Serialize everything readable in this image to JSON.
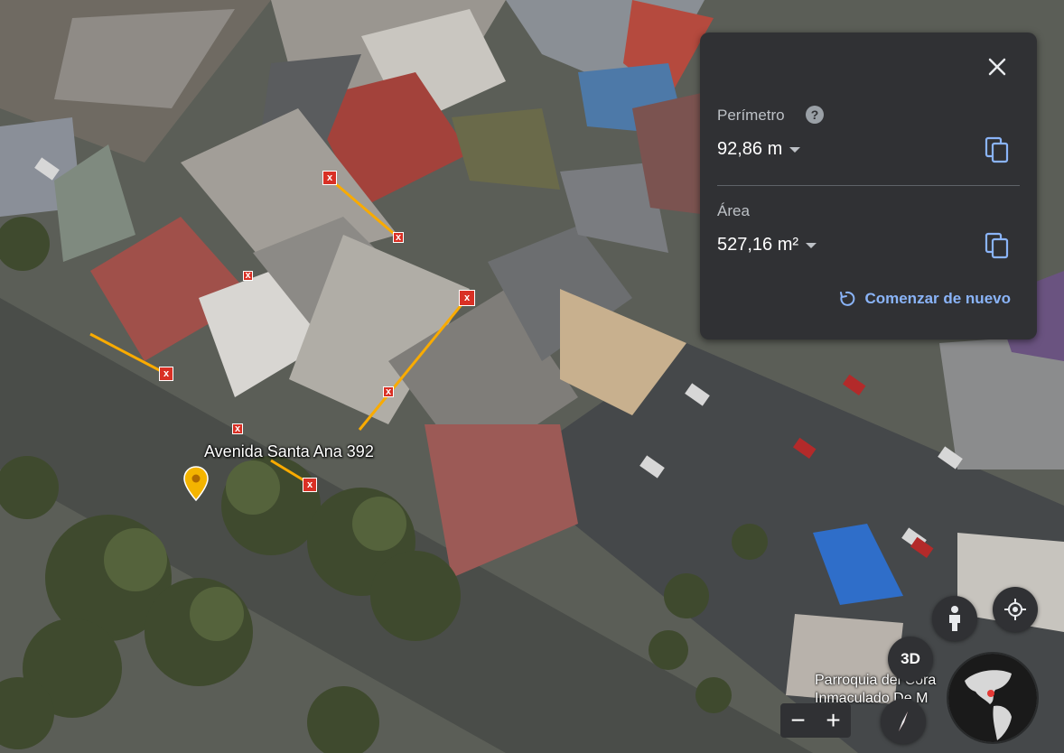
{
  "map": {
    "address_label": "Avenida Santa Ana 392",
    "place_label_line1": "Parroquia del Cora",
    "place_label_line2": "Inmaculado De M"
  },
  "measure_panel": {
    "perimeter_label": "Perímetro",
    "perimeter_value": "92,86 m",
    "area_label": "Área",
    "area_value": "527,16 m²",
    "restart_label": "Comenzar de nuevo"
  },
  "controls": {
    "btn_3d": "3D",
    "zoom_out": "−",
    "zoom_in": "+"
  },
  "markers": {
    "symbol": "x"
  },
  "colors": {
    "panel_bg": "#303134",
    "accent_blue": "#8ab4f8",
    "measure_line": "#f9ab00",
    "marker_red": "#d93025",
    "pin_yellow": "#f4b400"
  }
}
